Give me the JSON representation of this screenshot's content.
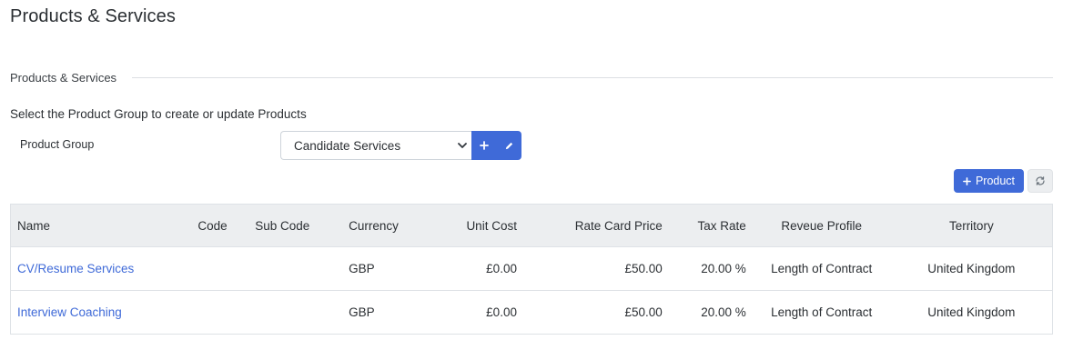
{
  "page": {
    "title": "Products & Services"
  },
  "section": {
    "label": "Products & Services"
  },
  "instruction": "Select the Product Group to create or update Products",
  "product_group": {
    "label": "Product Group",
    "selected": "Candidate Services"
  },
  "actions": {
    "add_product_label": "Product"
  },
  "icons": {
    "add": "plus-icon",
    "edit": "pencil-icon",
    "refresh": "refresh-icon",
    "dropdown": "chevron-down-icon"
  },
  "colors": {
    "accent": "#3f6ad8",
    "header_bg": "#eceef0"
  },
  "table": {
    "columns": {
      "name": "Name",
      "code": "Code",
      "sub_code": "Sub Code",
      "currency": "Currency",
      "unit_cost": "Unit Cost",
      "rate_card_price": "Rate Card Price",
      "tax_rate": "Tax Rate",
      "revenue_profile": "Reveue Profile",
      "territory": "Territory"
    },
    "rows": [
      {
        "name": "CV/Resume Services",
        "code": "",
        "sub_code": "",
        "currency": "GBP",
        "unit_cost": "£0.00",
        "rate_card_price": "£50.00",
        "tax_rate": "20.00 %",
        "revenue_profile": "Length of Contract",
        "territory": "United Kingdom"
      },
      {
        "name": "Interview Coaching",
        "code": "",
        "sub_code": "",
        "currency": "GBP",
        "unit_cost": "£0.00",
        "rate_card_price": "£50.00",
        "tax_rate": "20.00 %",
        "revenue_profile": "Length of Contract",
        "territory": "United Kingdom"
      }
    ]
  }
}
